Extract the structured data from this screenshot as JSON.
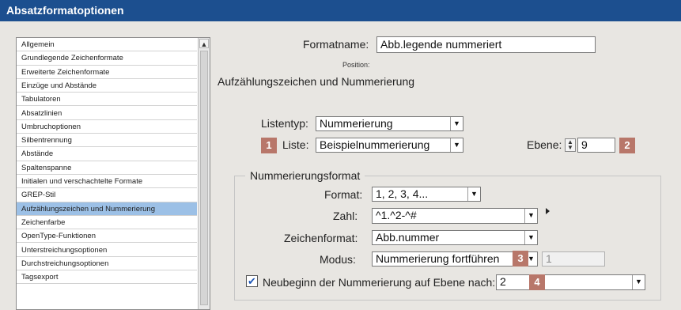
{
  "window": {
    "title": "Absatzformatoptionen"
  },
  "sidebar": {
    "items": [
      {
        "label": "Allgemein"
      },
      {
        "label": "Grundlegende Zeichenformate"
      },
      {
        "label": "Erweiterte Zeichenformate"
      },
      {
        "label": "Einzüge und Abstände"
      },
      {
        "label": "Tabulatoren"
      },
      {
        "label": "Absatzlinien"
      },
      {
        "label": "Umbruchoptionen"
      },
      {
        "label": "Silbentrennung"
      },
      {
        "label": "Abstände"
      },
      {
        "label": "Spaltenspanne"
      },
      {
        "label": "Initialen und verschachtelte Formate"
      },
      {
        "label": "GREP-Stil"
      },
      {
        "label": "Aufzählungszeichen und Nummerierung",
        "selected": true
      },
      {
        "label": "Zeichenfarbe"
      },
      {
        "label": "OpenType-Funktionen"
      },
      {
        "label": "Unterstreichungsoptionen"
      },
      {
        "label": "Durchstreichungsoptionen"
      },
      {
        "label": "Tagsexport"
      }
    ]
  },
  "main": {
    "formatname_label": "Formatname:",
    "formatname_value": "Abb.legende nummeriert",
    "position_label": "Position:",
    "section_title": "Aufzählungszeichen und Nummerierung",
    "listentyp_label": "Listentyp:",
    "listentyp_value": "Nummerierung",
    "liste_label": "Liste:",
    "liste_value": "Beispielnummerierung",
    "ebene_label": "Ebene:",
    "ebene_value": "9",
    "group_title": "Nummerierungsformat",
    "format_label": "Format:",
    "format_value": "1, 2, 3, 4...",
    "zahl_label": "Zahl:",
    "zahl_value": "^1.^2-^#",
    "zeichenformat_label": "Zeichenformat:",
    "zeichenformat_value": "Abb.nummer",
    "modus_label": "Modus:",
    "modus_value": "Nummerierung fortführen",
    "modus_extra_value": "1",
    "neubeginn_label": "Neubeginn der Nummerierung auf Ebene nach:",
    "neubeginn_value": "2",
    "neubeginn_checked": true
  },
  "badges": [
    "1",
    "2",
    "3",
    "4"
  ],
  "icons": {
    "dropdown": "chevron-down-icon",
    "scroll_up": "scroll-up-arrow-icon",
    "spinner": "up-down-spinner-icon",
    "insert_menu": "triangle-right-icon",
    "checkmark": "checkmark-icon"
  },
  "colors": {
    "titlebar": "#1c4f8f",
    "selection": "#9cc0e6",
    "badge": "#b8776a",
    "check": "#1d56b6"
  }
}
